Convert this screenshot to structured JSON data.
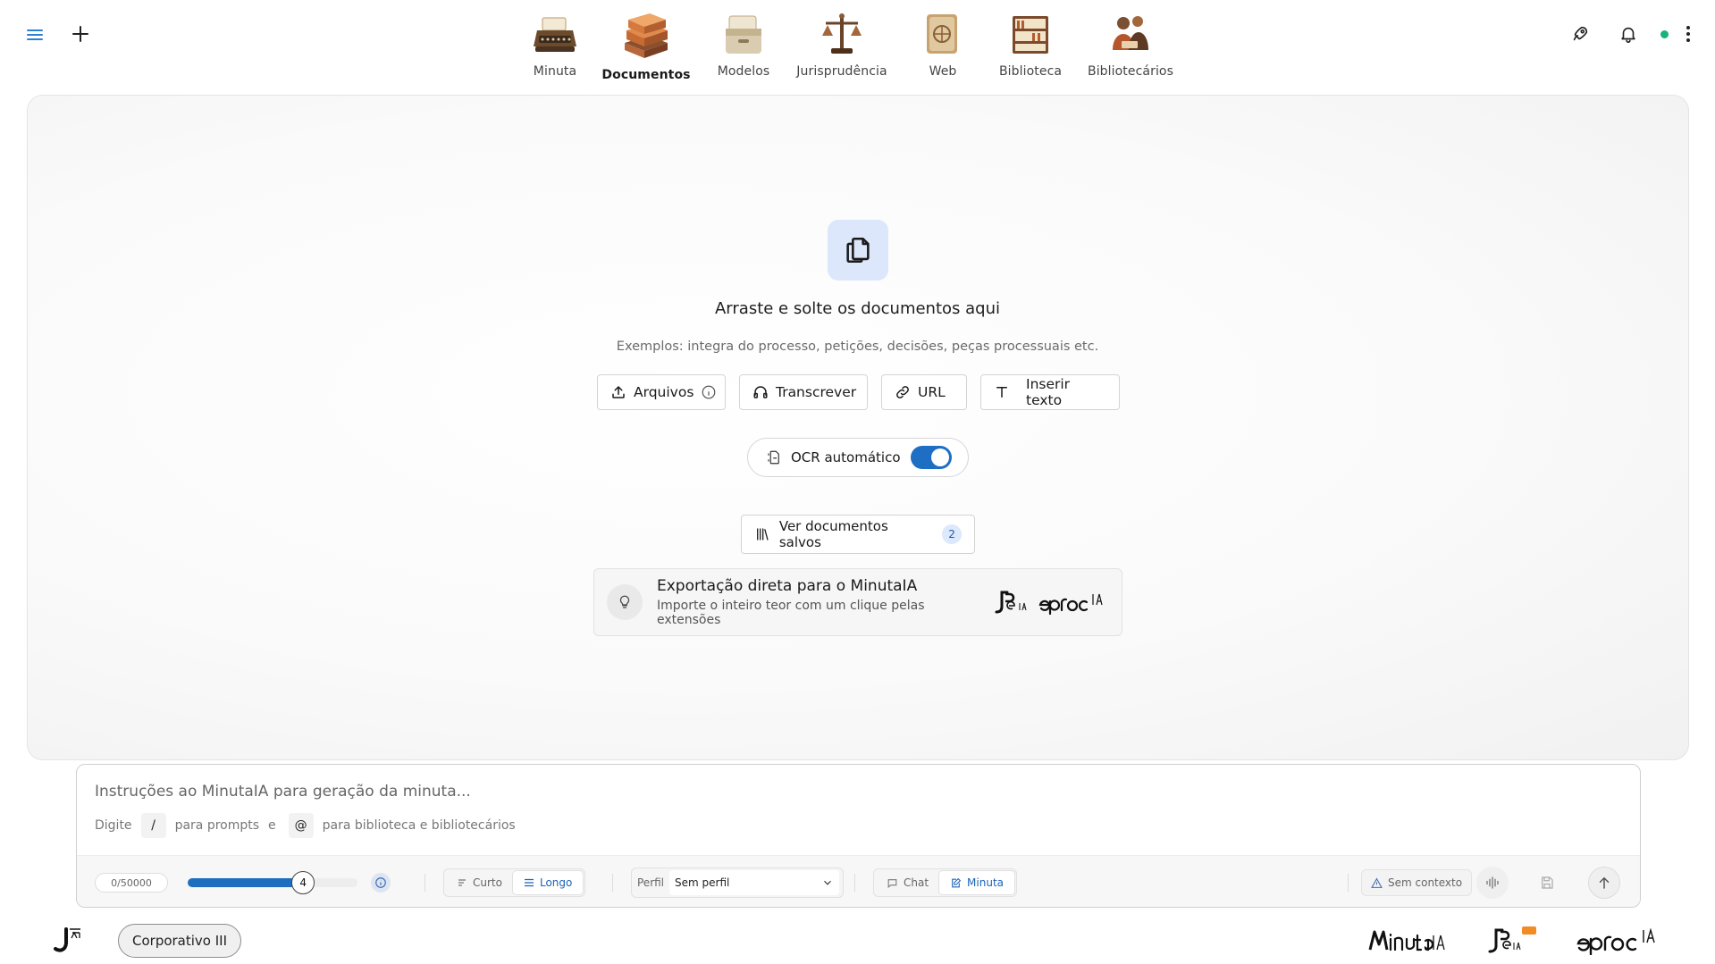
{
  "nav": {
    "items": [
      {
        "label": "Minuta",
        "icon": "typewriter-icon",
        "active": false
      },
      {
        "label": "Documentos",
        "icon": "books-stack-icon",
        "active": true
      },
      {
        "label": "Modelos",
        "icon": "file-box-icon",
        "active": false
      },
      {
        "label": "Jurisprudência",
        "icon": "scales-icon",
        "active": false
      },
      {
        "label": "Web",
        "icon": "globe-panel-icon",
        "active": false
      },
      {
        "label": "Biblioteca",
        "icon": "bookshelf-icon",
        "active": false
      },
      {
        "label": "Bibliotecários",
        "icon": "librarians-icon",
        "active": false
      }
    ]
  },
  "drop": {
    "title": "Arraste e solte os documentos aqui",
    "examples": "Exemplos: integra do processo, petições, decisões, peças processuais etc.",
    "buttons": {
      "files": "Arquivos",
      "transcribe": "Transcrever",
      "url": "URL",
      "insert_text": "Inserir texto"
    },
    "ocr_label": "OCR automático",
    "ocr_enabled": true,
    "saved_label": "Ver documentos salvos",
    "saved_count": "2"
  },
  "export": {
    "title": "Exportação direta para o MinutaIA",
    "subtitle": "Importe o inteiro teor com um clique pelas extensões"
  },
  "composer": {
    "placeholder": "Instruções ao MinutaIA para geração da minuta...",
    "hint_prefix": "Digite",
    "hint_slash_key": "/",
    "hint_slash_text": "para prompts",
    "hint_and": "e",
    "hint_at_key": "@",
    "hint_at_text": "para biblioteca e bibliotecários",
    "char_counter": "0/50000",
    "slider_value": "4",
    "slider_fraction": 0.68,
    "length_options": {
      "short": "Curto",
      "long": "Longo",
      "selected": "Longo"
    },
    "profile_label": "Perfil",
    "profile_value": "Sem perfil",
    "mode_options": {
      "chat": "Chat",
      "minuta": "Minuta",
      "selected": "Minuta"
    },
    "context_label": "Sem contexto"
  },
  "footer": {
    "org_name": "Corporativo III"
  },
  "colors": {
    "accent": "#1c6fbf",
    "status_online": "#18b37a",
    "icon_bg": "#dde7fb"
  }
}
